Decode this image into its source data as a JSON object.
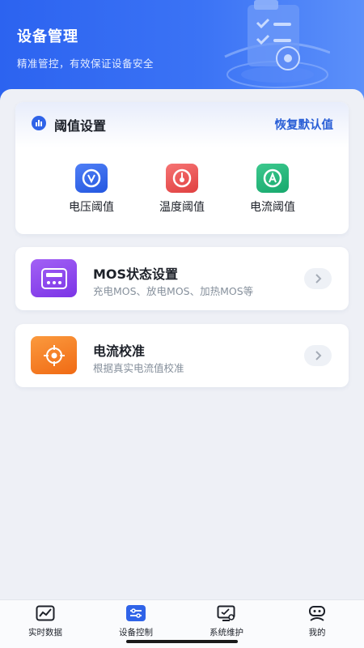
{
  "header": {
    "title": "设备管理",
    "subtitle": "精准管控，有效保证设备安全"
  },
  "threshold": {
    "title": "阈值设置",
    "reset_label": "恢复默认值",
    "items": [
      {
        "label": "电压阈值",
        "icon": "voltage-gauge-icon",
        "color": "#2f63e8"
      },
      {
        "label": "温度阈值",
        "icon": "temperature-gauge-icon",
        "color": "#e94d4d"
      },
      {
        "label": "电流阈值",
        "icon": "current-gauge-icon",
        "color": "#1fb278"
      }
    ]
  },
  "menu": [
    {
      "title": "MOS状态设置",
      "desc": "充电MOS、放电MOS、加热MOS等",
      "icon": "mos-chip-icon",
      "color": "#8b45ef"
    },
    {
      "title": "电流校准",
      "desc": "根据真实电流值校准",
      "icon": "crosshair-icon",
      "color": "#f47b22"
    }
  ],
  "tabbar": [
    {
      "label": "实时数据",
      "icon": "chart-monitor-icon",
      "active": false
    },
    {
      "label": "设备控制",
      "icon": "sliders-icon",
      "active": true
    },
    {
      "label": "系统维护",
      "icon": "monitor-search-icon",
      "active": false
    },
    {
      "label": "我的",
      "icon": "robot-user-icon",
      "active": false
    }
  ],
  "colors": {
    "primary": "#2c63f0",
    "accent_link": "#2a5fd6",
    "background": "#eef0f6"
  }
}
